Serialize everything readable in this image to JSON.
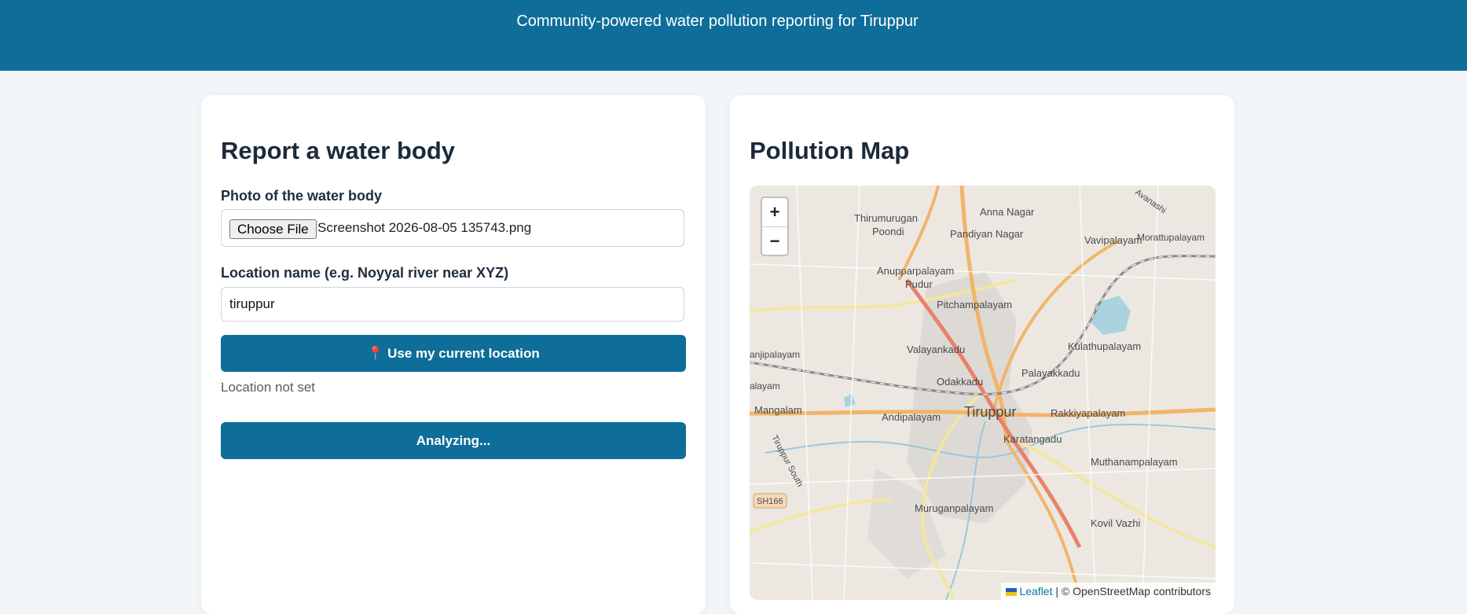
{
  "header": {
    "tagline": "Community-powered water pollution reporting for Tiruppur"
  },
  "report": {
    "title": "Report a water body",
    "photo_label": "Photo of the water body",
    "file_button": "Choose File",
    "file_name": "Screenshot 2026-08-05 135743.png",
    "location_label": "Location name (e.g. Noyyal river near XYZ)",
    "location_value": "tiruppur",
    "location_icon": "pin-icon",
    "use_location_button": "📍 Use my current location",
    "location_status": "Location not set",
    "submit_button": "Analyzing..."
  },
  "map": {
    "title": "Pollution Map",
    "zoom_in": "+",
    "zoom_out": "−",
    "attribution_leaflet": "Leaflet",
    "attribution_sep": "|",
    "attribution_osm": "© OpenStreetMap contributors",
    "places": {
      "tirumurugan": "Thirumurugan",
      "poondi": "Poondi",
      "anna_nagar": "Anna Nagar",
      "pandiyan_nagar": "Pandiyan Nagar",
      "vavipalayam": "Vavipalayam",
      "morattupalayam": "Morattupalayam",
      "anupparpalayam": "Anupparpalayam",
      "pudur": "Pudur",
      "pitchampalayam": "Pitchampalayam",
      "valayankadu": "Valayankadu",
      "kulathupalayam": "Kulathupalayam",
      "anjipalayam": "anjipalayam",
      "palayam": "alayam",
      "odakkadu": "Odakkadu",
      "palayakkadu": "Palayakkadu",
      "mangalam": "Mangalam",
      "andipalayam": "Andipalayam",
      "tiruppur": "Tiruppur",
      "rakkiyapalayam": "Rakkiyapalayam",
      "karatangadu": "Karatangadu",
      "muthanampalayam": "Muthanampalayam",
      "tiruppur_south": "Tiruppur South",
      "sh166": "SH166",
      "muruganpalayam": "Muruganpalayam",
      "kovil_vazhi": "Kovil Vazhi",
      "avanashi": "Avanashi"
    }
  },
  "colors": {
    "brand": "#0e6e99",
    "background": "#f2f6f9",
    "card": "#ffffff"
  }
}
